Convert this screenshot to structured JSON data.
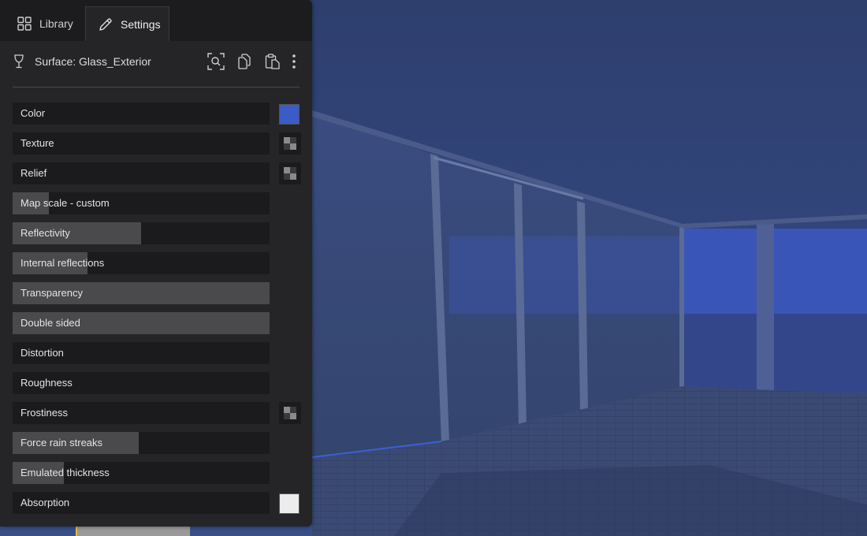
{
  "tabs": [
    {
      "label": "Library",
      "icon": "grid-icon",
      "active": false
    },
    {
      "label": "Settings",
      "icon": "pencil-icon",
      "active": true
    }
  ],
  "surface": {
    "title": "Surface: Glass_Exterior",
    "icon": "wineglass-icon",
    "actions": [
      "search-icon",
      "copy-icon",
      "paste-icon",
      "more-vertical-icon"
    ]
  },
  "properties": [
    {
      "label": "Color",
      "level": 0,
      "control": "swatch",
      "swatch_color": "#3b5bc6"
    },
    {
      "label": "Texture",
      "level": 0,
      "control": "texture"
    },
    {
      "label": "Relief",
      "level": 0,
      "control": "texture"
    },
    {
      "label": "Map scale - custom",
      "level": 0.14,
      "control": "none"
    },
    {
      "label": "Reflectivity",
      "level": 0.5,
      "control": "none"
    },
    {
      "label": "Internal reflections",
      "level": 0.29,
      "control": "none"
    },
    {
      "label": "Transparency",
      "level": 1.0,
      "control": "none"
    },
    {
      "label": "Double sided",
      "level": 1.0,
      "control": "none"
    },
    {
      "label": "Distortion",
      "level": 0,
      "control": "none"
    },
    {
      "label": "Roughness",
      "level": 0,
      "control": "none"
    },
    {
      "label": "Frostiness",
      "level": 0,
      "control": "texture"
    },
    {
      "label": "Force rain streaks",
      "level": 0.49,
      "control": "none"
    },
    {
      "label": "Emulated thickness",
      "level": 0.2,
      "control": "none"
    },
    {
      "label": "Absorption",
      "level": 0,
      "control": "swatch",
      "swatch_color": "#ececec"
    }
  ],
  "colors": {
    "panel_bg": "#252527",
    "slider_bg": "#1b1b1d",
    "slider_fill": "#4a4a4c",
    "sky": "#31457c"
  }
}
